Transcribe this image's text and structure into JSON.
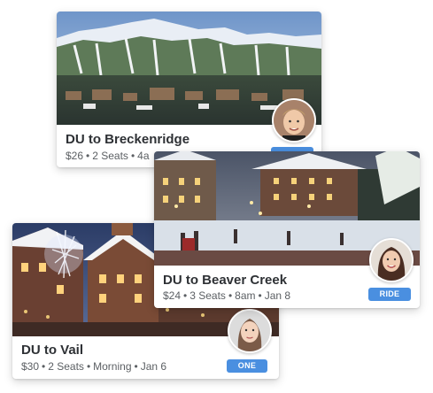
{
  "cards": [
    {
      "title": "DU to Breckenridge",
      "price": "$26",
      "seats": "2 Seats",
      "time": "4a",
      "badge": "",
      "image_icon": "mountain-town-photo",
      "avatar_icon": "driver-avatar-male"
    },
    {
      "title": "DU to Beaver Creek",
      "price": "$24",
      "seats": "3 Seats",
      "time": "8am",
      "date": "Jan 8",
      "badge": "RIDE",
      "image_icon": "ski-village-photo",
      "avatar_icon": "driver-avatar-female"
    },
    {
      "title": "DU to Vail",
      "price": "$30",
      "seats": "2 Seats",
      "time": "Morning",
      "date": "Jan 6",
      "badge": "ONE WAY",
      "image_icon": "vail-village-photo",
      "avatar_icon": "driver-avatar-female"
    }
  ],
  "separator": "•",
  "colors": {
    "badge": "#4a8fe0",
    "title": "#2e3135",
    "meta": "#5b5f63"
  }
}
